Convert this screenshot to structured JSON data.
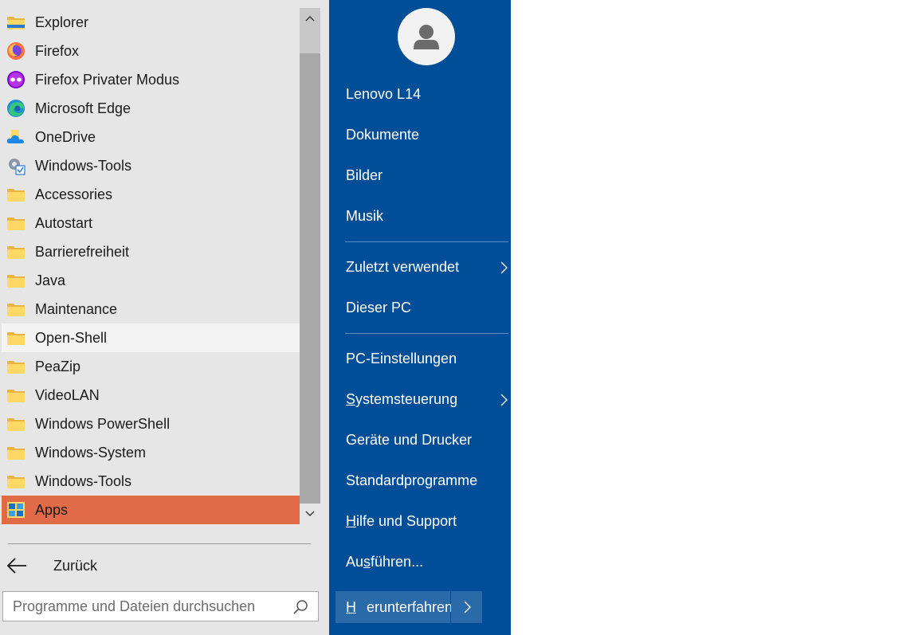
{
  "program_list": [
    {
      "label": "Explorer",
      "icon": "file-explorer-icon"
    },
    {
      "label": "Firefox",
      "icon": "firefox-icon"
    },
    {
      "label": "Firefox Privater Modus",
      "icon": "firefox-private-icon"
    },
    {
      "label": "Microsoft Edge",
      "icon": "edge-icon"
    },
    {
      "label": "OneDrive",
      "icon": "onedrive-icon"
    },
    {
      "label": "Windows-Tools",
      "icon": "windows-tools-icon"
    },
    {
      "label": "Accessories",
      "icon": "folder-icon"
    },
    {
      "label": "Autostart",
      "icon": "folder-icon"
    },
    {
      "label": "Barrierefreiheit",
      "icon": "folder-icon"
    },
    {
      "label": "Java",
      "icon": "folder-icon"
    },
    {
      "label": "Maintenance",
      "icon": "folder-icon"
    },
    {
      "label": "Open-Shell",
      "icon": "folder-icon"
    },
    {
      "label": "PeaZip",
      "icon": "folder-icon"
    },
    {
      "label": "VideoLAN",
      "icon": "folder-icon"
    },
    {
      "label": "Windows PowerShell",
      "icon": "folder-icon"
    },
    {
      "label": "Windows-System",
      "icon": "folder-icon"
    },
    {
      "label": "Windows-Tools",
      "icon": "folder-icon"
    },
    {
      "label": "Apps",
      "icon": "apps-icon"
    }
  ],
  "back": {
    "label": "Zurück"
  },
  "search": {
    "placeholder": "Programme und Dateien durchsuchen"
  },
  "right_menu": {
    "user": "Lenovo L14",
    "documents": "Dokumente",
    "pictures": "Bilder",
    "music": "Musik",
    "recent": "Zuletzt verwendet",
    "this_pc": "Dieser PC",
    "pc_settings": "PC-Einstellungen",
    "control_panel": {
      "first": "S",
      "rest": "ystemsteuerung"
    },
    "devices": "Geräte und Drucker",
    "default_programs": "Standardprogramme",
    "help": {
      "first": "H",
      "rest": "ilfe und Support"
    },
    "run": {
      "pre": "Au",
      "key": "s",
      "post": "führen..."
    },
    "shutdown": {
      "first": "H",
      "rest": "erunterfahren"
    }
  },
  "colors": {
    "left_bg": "#e6e6e6",
    "right_bg": "#004e98",
    "selected": "#e16b48",
    "hover": "#f4f4f4"
  }
}
